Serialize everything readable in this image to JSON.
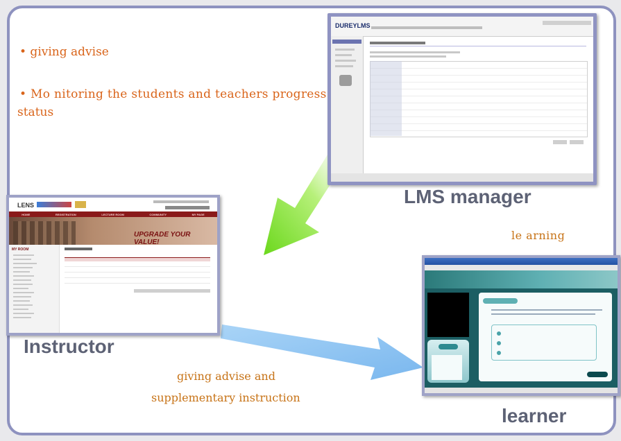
{
  "bullets": [
    "• giving advise",
    "• Mo nitoring  the students and teachers progress",
    "status"
  ],
  "labels": {
    "lms_manager": "LMS manager",
    "instructor": "Instructor",
    "learner": "learner",
    "learning": "le arning",
    "advise_line1": "giving advise and",
    "advise_line2": "supplementary instruction"
  },
  "instructor_screen": {
    "logo": "LENS",
    "banner": "UPGRADE YOUR VALUE!",
    "nav": [
      "HOME",
      "REGISTRATION",
      "LECTURE ROOM",
      "COMMUNITY",
      "MY PAGE"
    ],
    "sidebar_title": "MY ROOM"
  },
  "lms_screen": {
    "logo": "DUREYLMS"
  },
  "colors": {
    "frame_border": "#8e92bf",
    "bullet_orange": "#d9641a",
    "label_gray": "#5d6275",
    "green_arrow": "#7fe02a",
    "blue_arrow": "#8fc4f2"
  }
}
